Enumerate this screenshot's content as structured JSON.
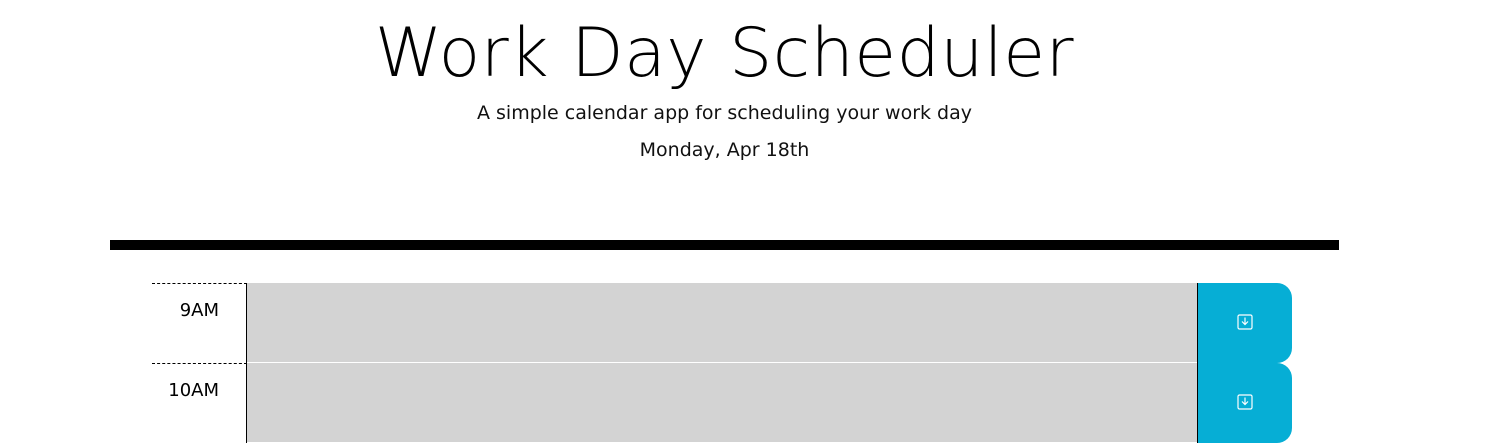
{
  "header": {
    "title": "Work Day Scheduler",
    "lead": "A simple calendar app for scheduling your work day",
    "current_day": "Monday, Apr 18th"
  },
  "time_blocks": [
    {
      "hour": "9AM",
      "description": ""
    },
    {
      "hour": "10AM",
      "description": ""
    }
  ],
  "colors": {
    "past": "#d3d3d3",
    "save_button": "#06aed5"
  },
  "icons": {
    "save": "save-icon"
  }
}
